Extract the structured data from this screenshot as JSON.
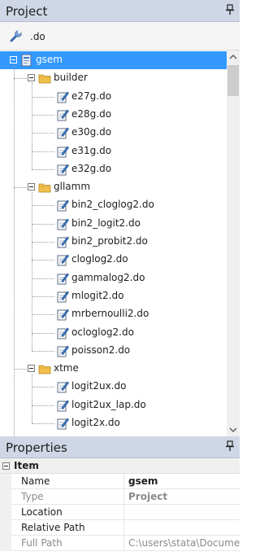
{
  "project_panel": {
    "title": "Project",
    "pin_icon": "pin-icon"
  },
  "toolbar": {
    "filter_value": ".do",
    "filter_icon": "wrench-icon"
  },
  "tree": {
    "root": "gsem",
    "groups": [
      {
        "name": "builder",
        "files": [
          "e27g.do",
          "e28g.do",
          "e30g.do",
          "e31g.do",
          "e32g.do"
        ]
      },
      {
        "name": "gllamm",
        "files": [
          "bin2_cloglog2.do",
          "bin2_logit2.do",
          "bin2_probit2.do",
          "cloglog2.do",
          "gammalog2.do",
          "mlogit2.do",
          "mrbernoulli2.do",
          "ocloglog2.do",
          "poisson2.do"
        ]
      },
      {
        "name": "xtme",
        "files": [
          "logit2ux.do",
          "logit2ux_lap.do",
          "logit2x.do"
        ]
      }
    ]
  },
  "properties_panel": {
    "title": "Properties",
    "category": "Item",
    "rows": [
      {
        "name": "Name",
        "value": "gsem"
      },
      {
        "name": "Type",
        "value": "Project"
      },
      {
        "name": "Location",
        "value": ""
      },
      {
        "name": "Relative Path",
        "value": ""
      },
      {
        "name": "Full Path",
        "value": "C:\\users\\stata\\Docume"
      }
    ]
  },
  "colors": {
    "header_bg": "#cfd6e5",
    "selection": "#3399ff",
    "folder": "#f0c04a"
  }
}
